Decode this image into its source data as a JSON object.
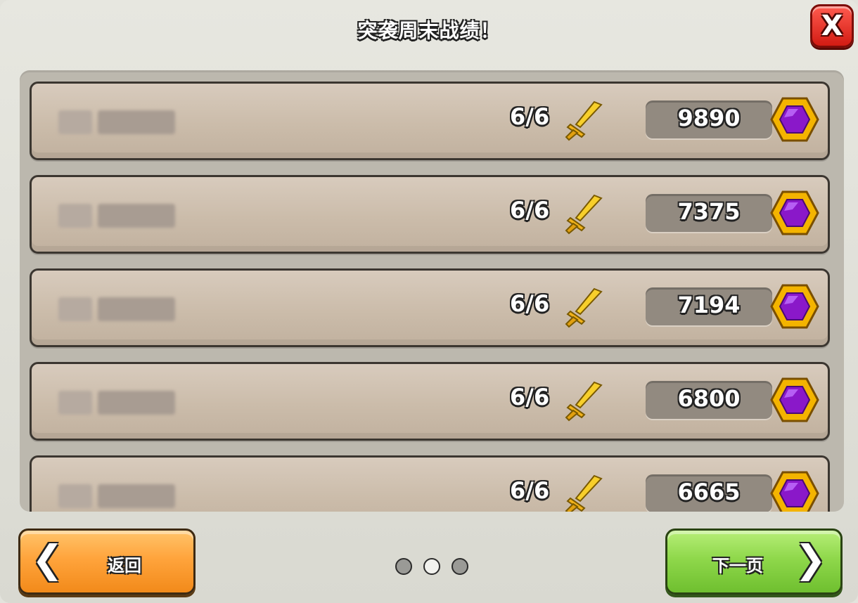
{
  "header": {
    "title": "突袭周末战绩！",
    "close_label": "X"
  },
  "rows": [
    {
      "attacks": "6/6",
      "medals": "9890"
    },
    {
      "attacks": "6/6",
      "medals": "7375"
    },
    {
      "attacks": "6/6",
      "medals": "7194"
    },
    {
      "attacks": "6/6",
      "medals": "6800"
    },
    {
      "attacks": "6/6",
      "medals": "6665"
    }
  ],
  "footer": {
    "back_label": "返回",
    "back_chevron": "❮",
    "next_label": "下一页",
    "next_chevron": "❯",
    "pager": {
      "pages": 3,
      "current": 2
    }
  },
  "colors": {
    "sword": "#f3c21b",
    "gem_outer": "#f4b400",
    "gem_inner": "#8a18c9",
    "dot_active": "#f2f2ee",
    "dot_inactive": "#9a9a96"
  },
  "icons": {
    "attack": "sword-icon",
    "medal": "purple-gem-icon",
    "close": "close-icon"
  }
}
